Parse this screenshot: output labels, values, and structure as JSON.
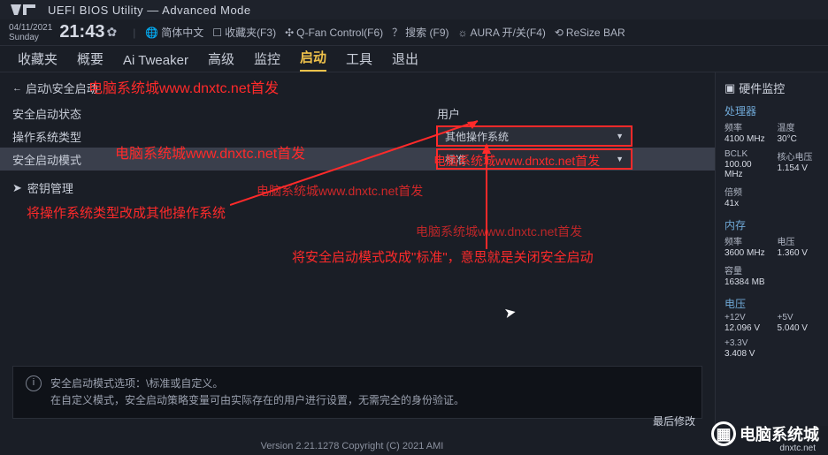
{
  "header": {
    "title": "UEFI BIOS Utility — Advanced Mode"
  },
  "topbar": {
    "date": "04/11/2021",
    "day": "Sunday",
    "time": "21:43",
    "lang": "简体中文",
    "fav": "收藏夹(F3)",
    "qfan": "Q-Fan Control(F6)",
    "search": "搜索 (F9)",
    "aura": "AURA 开/关(F4)",
    "resize": "ReSize BAR"
  },
  "tabs": [
    "收藏夹",
    "概要",
    "Ai Tweaker",
    "高级",
    "监控",
    "启动",
    "工具",
    "退出"
  ],
  "active_tab": "启动",
  "breadcrumb": "启动\\安全启动",
  "rows": {
    "status_label": "安全启动状态",
    "status_value": "用户",
    "ostype_label": "操作系统类型",
    "ostype_value": "其他操作系统",
    "mode_label": "安全启动模式",
    "mode_value": "标准",
    "keymgmt": "密钥管理"
  },
  "info": {
    "line1": "安全启动模式选项：\\标准或自定义。",
    "line2": "在自定义模式，安全启动策略变量可由实际存在的用户进行设置，无需完全的身份验证。"
  },
  "side": {
    "title": "硬件监控",
    "cpu": "处理器",
    "freq_lbl": "频率",
    "freq_val": "4100 MHz",
    "temp_lbl": "温度",
    "temp_val": "30°C",
    "bclk_lbl": "BCLK",
    "bclk_val": "100.00 MHz",
    "vcore_lbl": "核心电压",
    "vcore_val": "1.154 V",
    "ratio_lbl": "倍频",
    "ratio_val": "41x",
    "mem": "内存",
    "mfreq_lbl": "频率",
    "mfreq_val": "3600 MHz",
    "mvolt_lbl": "电压",
    "mvolt_val": "1.360 V",
    "cap_lbl": "容量",
    "cap_val": "16384 MB",
    "volt": "电压",
    "v12_lbl": "+12V",
    "v12_val": "12.096 V",
    "v5_lbl": "+5V",
    "v5_val": "5.040 V",
    "v33_lbl": "+3.3V",
    "v33_val": "3.408 V"
  },
  "watermarks": {
    "w1": "电脑系统城www.dnxtc.net首发",
    "w2": "电脑系统城www.dnxtc.net首发",
    "w3": "电脑系统城www.dnxtc.net首发",
    "w4": "电脑系统城www.dnxtc.net首发",
    "w5": "电脑系统城www.dnxtc.net首发"
  },
  "annotations": {
    "a1": "将操作系统类型改成其他操作系统",
    "a2": "将安全启动模式改成\"标准\"，意思就是关闭安全启动"
  },
  "footer": {
    "version": "Version 2.21.1278 Copyright (C) 2021 AMI",
    "last_mod": "最后修改",
    "corner_text": "电脑系统城",
    "corner_url": "dnxtc.net"
  }
}
